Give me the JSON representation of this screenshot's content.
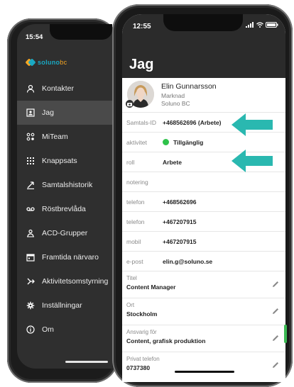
{
  "colors": {
    "accent_cyan": "#1aa9c3",
    "accent_orange": "#f6a623",
    "arrow_teal": "#2ab8b0",
    "status_green": "#2ec24a",
    "sidebar_bg": "#2f2f2f",
    "header_bg": "#2b2b2b"
  },
  "back_phone": {
    "time": "15:54",
    "logo": {
      "part1": "soluno",
      "part2": "bc"
    },
    "menu": [
      {
        "label": "Kontakter",
        "icon": "person-icon"
      },
      {
        "label": "Jag",
        "icon": "contact-card-icon",
        "active": true
      },
      {
        "label": "MiTeam",
        "icon": "team-icon"
      },
      {
        "label": "Knappsats",
        "icon": "keypad-icon"
      },
      {
        "label": "Samtalshistorik",
        "icon": "call-history-icon"
      },
      {
        "label": "Röstbrevlåda",
        "icon": "voicemail-icon"
      },
      {
        "label": "ACD-Grupper",
        "icon": "acd-group-icon"
      },
      {
        "label": "Framtida närvaro",
        "icon": "calendar-icon"
      },
      {
        "label": "Aktivitetsomstyrning",
        "icon": "redirect-icon"
      },
      {
        "label": "Inställningar",
        "icon": "gear-icon"
      },
      {
        "label": "Om",
        "icon": "info-icon"
      }
    ]
  },
  "front_phone": {
    "time": "12:55",
    "title": "Jag",
    "profile": {
      "name": "Elin Gunnarsson",
      "department": "Marknad",
      "company": "Soluno BC"
    },
    "fields": [
      {
        "label": "Samtals-ID",
        "value": "+468562696 (Arbete)"
      },
      {
        "label": "aktivitet",
        "value": "Tillgänglig",
        "status": "available"
      },
      {
        "label": "roll",
        "value": "Arbete"
      },
      {
        "label": "notering",
        "value": ""
      },
      {
        "label": "telefon",
        "value": "+468562696"
      },
      {
        "label": "telefon",
        "value": "+467207915"
      },
      {
        "label": "mobil",
        "value": "+467207915"
      },
      {
        "label": "e-post",
        "value": "elin.g@soluno.se"
      }
    ],
    "editable_fields": [
      {
        "label": "Titel",
        "value": "Content Manager"
      },
      {
        "label": "Ort",
        "value": "Stockholm"
      },
      {
        "label": "Ansvarig för",
        "value": "Content, grafisk produktion"
      },
      {
        "label": "Privat telefon",
        "value": "0737380"
      }
    ]
  }
}
